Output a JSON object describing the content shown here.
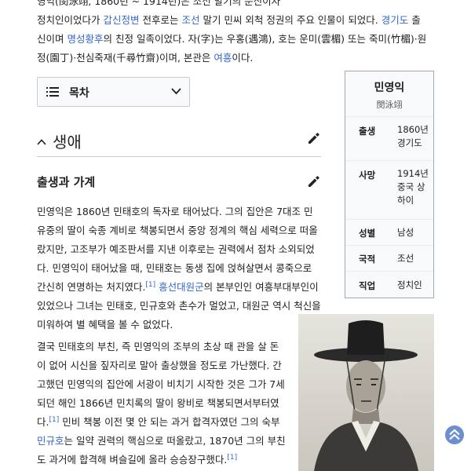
{
  "intro": {
    "line1": "영익(閔泳翊, 1860년 ~ 1914년)은 조선 말기의 문신이자",
    "line2a": "정치인이었다가 ",
    "line2_link1": "갑신정변",
    "line2b": " 전후로는 ",
    "line2_link2": "조선",
    "line2c": " 말기 민씨 외척 정권의 주요 인물이 되었다. ",
    "line2_link3": "경기도",
    "line2d": " 출",
    "line3a": "신이며 ",
    "line3_link": "명성황후",
    "line3b": "의 친정 일족이었다. 자(字)는 우홍(遇鴻), 호는 운미(雲楣) 또는 죽미(竹楣)·원",
    "line4a": "정(園丁)·천심죽재(千尋竹齋)이며, 본관은 ",
    "line4_link": "여흥",
    "line4b": "이다."
  },
  "toc": {
    "label": "목차"
  },
  "section": {
    "title": "생애"
  },
  "subsection": {
    "title": "출생과 가계"
  },
  "para1": {
    "a": "민영익은 1860년 민태호의 독자로 태어났다. 그의 집안은 7대조 민유중의 딸이 숙종 계비로 책봉되면서 중앙 정계의 핵심 세력으로 떠올랐지만, 고조부가 예조판서를 지낸 이후로는 권력에서 점차 소외되었다. 민영익이 태어났을 때, 민태호는 동생 집에 얹혀살면서 콩죽으로 간신히 연명하는 처지였다.",
    "ref": "[1]",
    "link": "흥선대원군",
    "b": "의 본부인인 여흥부대부인이 있었으나 그녀는 민태호, 민규호와 촌수가 멀었고, 대원군 역시 척신을 미워하여 별 혜택을 볼 수 없었다."
  },
  "para2": {
    "a": "결국 민태호의 부친, 즉 민영익의 조부의 초상 때 관을 살 돈이 없어 시신을 짚자리로 말아 출상했을 정도로 가난했다. 간고했던 민영익의 집안에 서광이 비치기 시작한 것은 그가 7세 되던 해인 1866년 민치록의 딸이 왕비로 책봉되면서부터였다.",
    "ref1": "[1]",
    "b": " 민비 책봉 이전 몇 안 되는 과거 합격자였던 그의 숙부 ",
    "link": "민규호",
    "c": "는 일약 권력의 핵심으로 떠올랐고, 1870년 그의 부친도 과거에 합격해 벼슬길에 올라 승승장구했다.",
    "ref2": "[1]"
  },
  "infobox": {
    "name": "민영익",
    "hanja": "閔泳翊",
    "rows": [
      {
        "key": "출생",
        "value": "1860년 경기도"
      },
      {
        "key": "사망",
        "value": "1914년 중국 상하이"
      },
      {
        "key": "성별",
        "value": "남성"
      },
      {
        "key": "국적",
        "value": "조선"
      },
      {
        "key": "직업",
        "value": "정치인"
      }
    ]
  },
  "colors": {
    "link": "#3366cc",
    "text": "#202122",
    "border": "#a2a9b1"
  }
}
